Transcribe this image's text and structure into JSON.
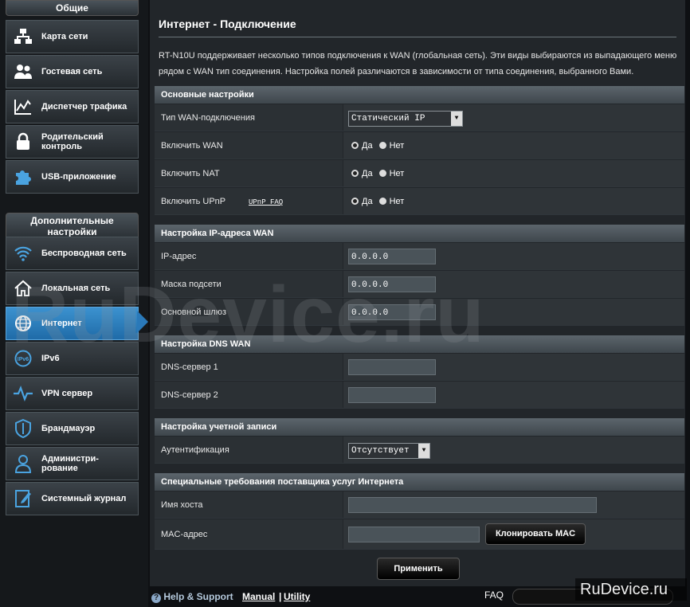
{
  "sidebar": {
    "general_title": "Общие",
    "advanced_title": "Дополнительные настройки",
    "general_items": [
      {
        "label": "Карта сети",
        "icon": "network-map-icon"
      },
      {
        "label": "Гостевая сеть",
        "icon": "guest-network-icon"
      },
      {
        "label": "Диспетчер трафика",
        "icon": "traffic-manager-icon"
      },
      {
        "label": "Родительский контроль",
        "icon": "parental-lock-icon"
      },
      {
        "label": "USB-приложение",
        "icon": "usb-puzzle-icon"
      }
    ],
    "advanced_items": [
      {
        "label": "Беспроводная сеть",
        "icon": "wifi-icon"
      },
      {
        "label": "Локальная сеть",
        "icon": "home-icon"
      },
      {
        "label": "Интернет",
        "icon": "globe-icon"
      },
      {
        "label": "IPv6",
        "icon": "ipv6-icon"
      },
      {
        "label": "VPN сервер",
        "icon": "vpn-icon"
      },
      {
        "label": "Брандмауэр",
        "icon": "shield-icon"
      },
      {
        "label": "Администри-рование",
        "icon": "admin-user-icon"
      },
      {
        "label": "Системный журнал",
        "icon": "log-icon"
      }
    ]
  },
  "main": {
    "title": "Интернет - Подключение",
    "description": "RT-N10U поддерживает несколько типов подключения к WAN (глобальная сеть). Эти виды выбираются из выпадающего меню рядом с WAN тип соединения. Настройка полей различаются в зависимости от типа соединения, выбранного Вами.",
    "basic": {
      "title": "Основные настройки",
      "wan_type_label": "Тип WAN-подключения",
      "wan_type_value": "Статический IP",
      "enable_wan_label": "Включить WAN",
      "enable_nat_label": "Включить NAT",
      "enable_upnp_label": "Включить UPnP",
      "upnp_faq": "UPnP FAQ",
      "yes": "Да",
      "no": "Нет"
    },
    "ip": {
      "title": "Настройка IP-адреса WAN",
      "ip_label": "IP-адрес",
      "ip_value": "0.0.0.0",
      "mask_label": "Маска подсети",
      "mask_value": "0.0.0.0",
      "gateway_label": "Основной шлюз",
      "gateway_value": "0.0.0.0"
    },
    "dns": {
      "title": "Настройка DNS WAN",
      "dns1_label": "DNS-сервер 1",
      "dns1_value": "",
      "dns2_label": "DNS-сервер 2",
      "dns2_value": ""
    },
    "account": {
      "title": "Настройка учетной записи",
      "auth_label": "Аутентификация",
      "auth_value": "Отсутствует"
    },
    "isp": {
      "title": "Специальные требования поставщика услуг Интернета",
      "host_label": "Имя хоста",
      "host_value": "",
      "mac_label": "MAC-адрес",
      "mac_value": "",
      "clone_button": "Клонировать MAC"
    },
    "apply_button": "Применить"
  },
  "footer": {
    "help": "Help & Support",
    "manual": "Manual",
    "separator": "|",
    "utility": "Utility",
    "faq": "FAQ"
  },
  "watermark": "RuDevice.ru",
  "watermark_corner": "RuDevice.ru"
}
